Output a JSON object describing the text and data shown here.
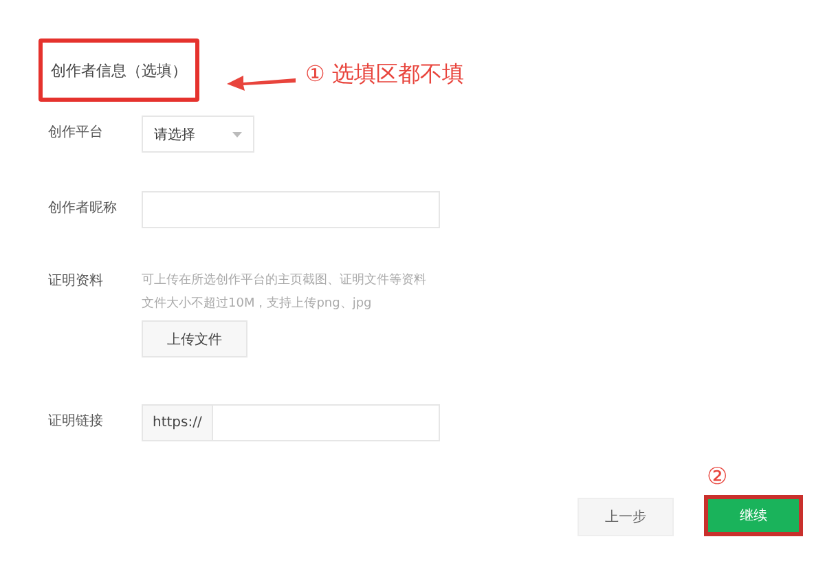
{
  "section": {
    "title": "创作者信息（选填）",
    "highlighted": true
  },
  "annotations": [
    {
      "kind": "callout",
      "text": "① 选填区都不填"
    },
    {
      "kind": "marker",
      "text": "②"
    }
  ],
  "fields": [
    {
      "kind": "select",
      "label": "创作平台",
      "placeholder": "请选择"
    },
    {
      "kind": "text",
      "label": "创作者昵称"
    },
    {
      "kind": "upload",
      "label": "证明资料",
      "hint": [
        "可上传在所选创作平台的主页截图、证明文件等资料",
        "文件大小不超过10M，支持上传png、jpg"
      ],
      "button": "上传文件"
    },
    {
      "kind": "url",
      "label": "证明链接",
      "prefix": "https://"
    }
  ],
  "buttons": [
    {
      "label": "上一步",
      "kind": "secondary",
      "highlighted": false
    },
    {
      "label": "继续",
      "kind": "primary",
      "highlighted": true
    }
  ]
}
